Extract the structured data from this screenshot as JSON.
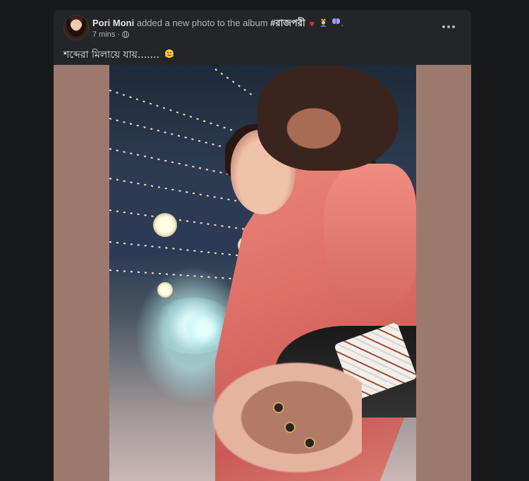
{
  "post": {
    "author": "Pori Moni",
    "action": "added a new photo to the album",
    "album": "#রাজপরী",
    "album_emojis": [
      "red-heart",
      "person-with-crown",
      "butterfly"
    ],
    "time": "7 mins",
    "privacy": "globe-icon",
    "caption": "শব্দেরা মিলায়ে যায়.......",
    "caption_emoji": "hugging-face"
  },
  "colors": {
    "page_bg": "#18191a",
    "card_bg": "#242526",
    "photo_bg": "#9b7a6d",
    "primary_text": "#e4e6eb",
    "secondary_text": "#b0b3b8"
  }
}
